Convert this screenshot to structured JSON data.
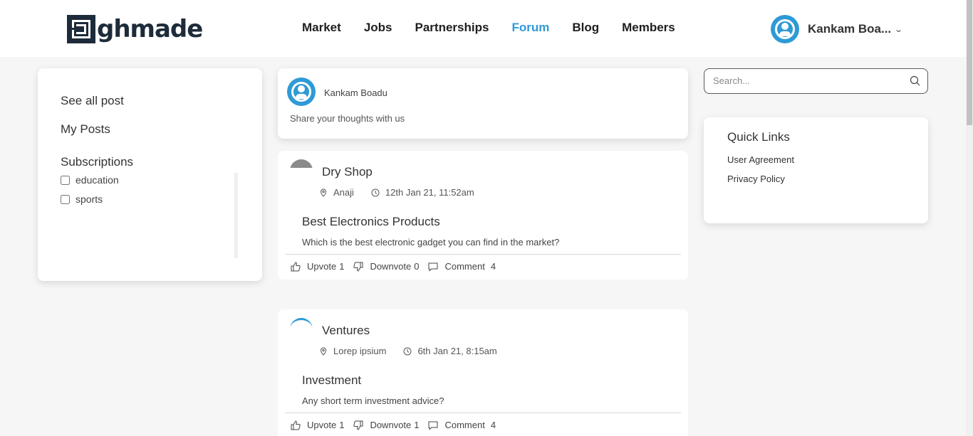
{
  "brand": {
    "logo_text": "ghmade",
    "logo_icon": "maze-logo-icon"
  },
  "nav": {
    "items": [
      {
        "label": "Market",
        "active": false
      },
      {
        "label": "Jobs",
        "active": false
      },
      {
        "label": "Partnerships",
        "active": false
      },
      {
        "label": "Forum",
        "active": true
      },
      {
        "label": "Blog",
        "active": false
      },
      {
        "label": "Members",
        "active": false
      }
    ],
    "active_color": "#2e9ad6"
  },
  "user_menu": {
    "name": "Kankam Boa...",
    "avatar_icon": "user-avatar-icon",
    "dropdown_icon": "chevron-down-icon"
  },
  "sidebar": {
    "see_all": "See all post",
    "my_posts": "My Posts",
    "subscriptions_title": "Subscriptions",
    "subscriptions": [
      {
        "label": "education",
        "checked": false
      },
      {
        "label": "sports",
        "checked": false
      }
    ]
  },
  "composer": {
    "name": "Kankam Boadu",
    "prompt": "Share your thoughts with us"
  },
  "posts": [
    {
      "author": "Dry Shop",
      "location": "Anaji",
      "time": "12th Jan 21, 11:52am",
      "title": "Best Electronics Products",
      "body": "Which is the best electronic gadget you can find in the market?",
      "upvote_label": "Upvote",
      "upvotes": "1",
      "downvote_label": "Downvote",
      "downvotes": "0",
      "comment_label": "Comment",
      "comments": "4"
    },
    {
      "author": "Ventures",
      "location": "Lorep ipsium",
      "time": "6th Jan 21, 8:15am",
      "title": "Investment",
      "body": "Any short term investment advice?",
      "upvote_label": "Upvote",
      "upvotes": "1",
      "downvote_label": "Downvote",
      "downvotes": "1",
      "comment_label": "Comment",
      "comments": "4"
    }
  ],
  "search": {
    "placeholder": "Search...",
    "value": ""
  },
  "quick_links": {
    "title": "Quick Links",
    "items": [
      "User Agreement",
      "Privacy Policy"
    ]
  }
}
